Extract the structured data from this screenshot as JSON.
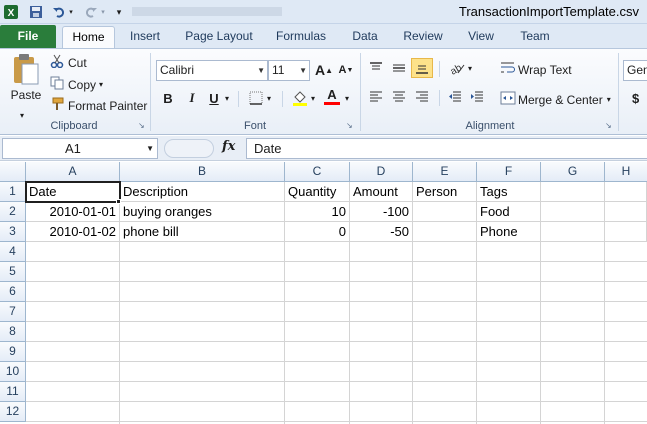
{
  "window": {
    "title": "TransactionImportTemplate.csv"
  },
  "quick_access": {
    "app_icon": "excel-icon",
    "save_icon": "save-icon",
    "undo_icon": "undo-icon",
    "redo_icon": "redo-icon",
    "customize_icon": "customize-qat-icon"
  },
  "tabs": [
    {
      "label": "File"
    },
    {
      "label": "Home"
    },
    {
      "label": "Insert"
    },
    {
      "label": "Page Layout"
    },
    {
      "label": "Formulas"
    },
    {
      "label": "Data"
    },
    {
      "label": "Review"
    },
    {
      "label": "View"
    },
    {
      "label": "Team"
    }
  ],
  "ribbon": {
    "clipboard": {
      "paste": "Paste",
      "cut": "Cut",
      "copy": "Copy",
      "format_painter": "Format Painter",
      "group_label": "Clipboard"
    },
    "font": {
      "font_name": "Calibri",
      "font_size": "11",
      "bold": "B",
      "italic": "I",
      "underline": "U",
      "grow": "A",
      "shrink": "A",
      "font_color_letter": "A",
      "group_label": "Font"
    },
    "alignment": {
      "wrap_text": "Wrap Text",
      "merge_center": "Merge & Center",
      "group_label": "Alignment"
    },
    "number": {
      "format": "Gen",
      "currency": "$"
    }
  },
  "formula_bar": {
    "name_box": "A1",
    "fx_label": "fx",
    "value": "Date"
  },
  "columns": [
    "A",
    "B",
    "C",
    "D",
    "E",
    "F",
    "G",
    "H"
  ],
  "rows": [
    "1",
    "2",
    "3",
    "4",
    "5",
    "6",
    "7",
    "8",
    "9",
    "10",
    "11",
    "12"
  ],
  "cells": [
    [
      "Date",
      "Description",
      "Quantity",
      "Amount",
      "Person",
      "Tags",
      "",
      ""
    ],
    [
      "2010-01-01",
      "buying oranges",
      "10",
      "-100",
      "",
      "Food",
      "",
      ""
    ],
    [
      "2010-01-02",
      "phone bill",
      "0",
      "-50",
      "",
      "Phone",
      "",
      ""
    ]
  ],
  "colors": {
    "file_tab": "#2a7d3b",
    "ribbon_bg": "#e9eff7",
    "header_text": "#27415f"
  }
}
